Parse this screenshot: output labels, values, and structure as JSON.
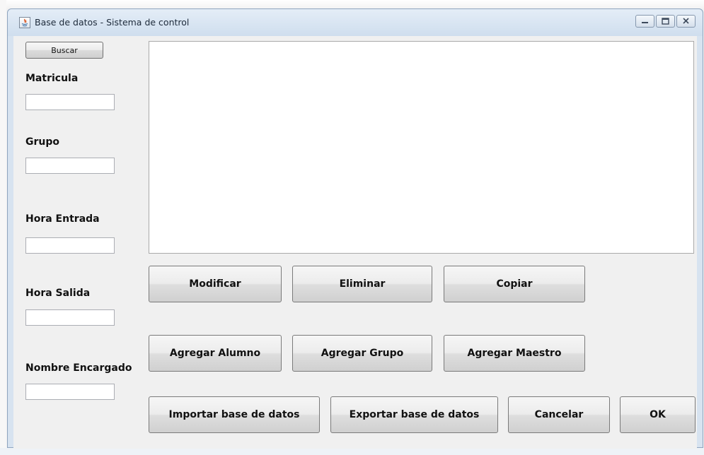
{
  "window": {
    "title": "Base de datos - Sistema de control"
  },
  "left_panel": {
    "search_button": "Buscar",
    "fields": [
      {
        "label": "Matricula",
        "value": ""
      },
      {
        "label": "Grupo",
        "value": ""
      },
      {
        "label": "Hora Entrada",
        "value": ""
      },
      {
        "label": "Hora Salida",
        "value": ""
      },
      {
        "label": "Nombre Encargado",
        "value": ""
      }
    ]
  },
  "output_area": {
    "value": ""
  },
  "buttons": {
    "modificar": "Modificar",
    "eliminar": "Eliminar",
    "copiar": "Copiar",
    "agregar_alumno": "Agregar Alumno",
    "agregar_grupo": "Agregar Grupo",
    "agregar_maestro": "Agregar Maestro",
    "importar": "Importar base de datos",
    "exportar": "Exportar base de datos",
    "cancelar": "Cancelar",
    "ok": "OK"
  },
  "icons": {
    "app": "java-app-icon",
    "minimize": "minimize-icon",
    "maximize": "maximize-icon",
    "close": "close-icon"
  }
}
